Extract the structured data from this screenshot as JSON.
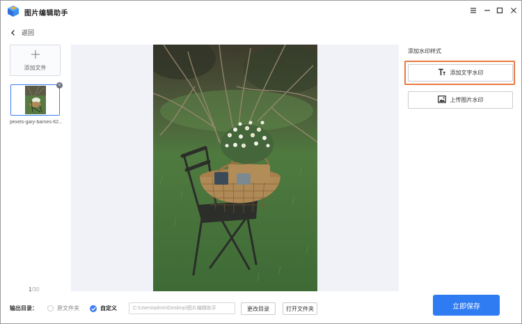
{
  "app": {
    "title": "图片编辑助手",
    "logo_icon": "app-logo-icon"
  },
  "window_controls": {
    "menu_icon": "menu-icon",
    "minimize_icon": "minimize-icon",
    "maximize_icon": "maximize-icon",
    "close_icon": "close-icon"
  },
  "nav": {
    "back_label": "返回"
  },
  "sidebar": {
    "add_file_label": "添加文件",
    "files": [
      {
        "name": "pexels-gary-barnes-62...",
        "selected": true
      }
    ],
    "page_current": "1",
    "page_total": "/30"
  },
  "watermark": {
    "section_title": "添加水印样式",
    "text_button_label": "添加文字水印",
    "image_button_label": "上传图片水印"
  },
  "output": {
    "label": "输出目录：",
    "option_original": "原文件夹",
    "option_custom": "自定义",
    "selected": "custom",
    "path_value": "C:\\Users\\admin\\Desktop\\图片编辑助手",
    "change_dir_label": "更改目录",
    "open_folder_label": "打开文件夹"
  },
  "actions": {
    "save_label": "立即保存"
  },
  "colors": {
    "accent": "#2f7bf2",
    "highlight_border": "#e8783e",
    "preview_bg": "#f0f2f8"
  }
}
